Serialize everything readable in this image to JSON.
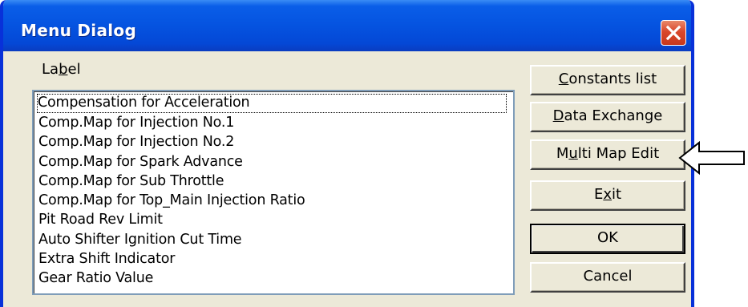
{
  "window": {
    "title": "Menu Dialog"
  },
  "label_caption": {
    "before": "La",
    "underlined": "b",
    "after": "el"
  },
  "list": {
    "items": [
      "Compensation for Acceleration",
      "Comp.Map for Injection No.1",
      "Comp.Map for Injection No.2",
      "Comp.Map for Spark Advance",
      "Comp.Map for Sub Throttle",
      "Comp.Map for Top_Main Injection Ratio",
      "Pit Road Rev Limit",
      "Auto Shifter Ignition Cut Time",
      "Extra Shift Indicator",
      "Gear Ratio Value"
    ],
    "focused_index": 0
  },
  "buttons": {
    "constants": {
      "before": "",
      "underlined": "C",
      "after": "onstants list"
    },
    "data_exchange": {
      "before": "",
      "underlined": "D",
      "after": "ata Exchange"
    },
    "multi_map": {
      "before": "M",
      "underlined": "u",
      "after": "lti Map Edit"
    },
    "exit": {
      "before": "E",
      "underlined": "x",
      "after": "it"
    },
    "ok": "OK",
    "cancel": "Cancel"
  },
  "icons": {
    "close": "close-icon",
    "pointer": "arrow-left-icon"
  },
  "colors": {
    "titlebar": "#0553e0",
    "close_button": "#d9472b",
    "dialog_face": "#ece9d8"
  }
}
